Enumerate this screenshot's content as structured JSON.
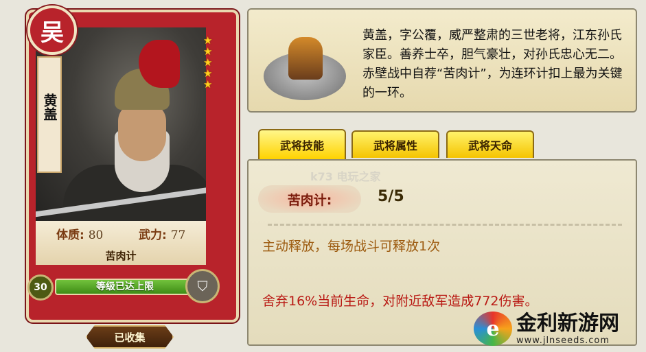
{
  "card": {
    "faction": "吴",
    "name": "黄盖",
    "stars": 5,
    "constitution_label": "体质:",
    "constitution_value": "80",
    "power_label": "武力:",
    "power_value": "77",
    "skill": "苦肉计",
    "level": "30",
    "level_status": "等级已达上限",
    "collected_label": "已收集"
  },
  "description": "黄盖，字公覆，威严整肃的三世老将，江东孙氏家臣。善养士卒，胆气豪壮，对孙氏忠心无二。赤壁战中自荐“苦肉计”，为连环计扣上最为关键的一环。",
  "tabs": [
    {
      "label": "武将技能",
      "active": true
    },
    {
      "label": "武将属性",
      "active": false
    },
    {
      "label": "武将天命",
      "active": false
    }
  ],
  "skill": {
    "name": "苦肉计:",
    "level": "5/5",
    "type": "主动释放，每场战斗可释放1次",
    "effect": "舍弃16%当前生命，对附近敌军造成772伤害。"
  },
  "watermarks": {
    "k73": "k73 电玩之家",
    "site_cn": "金利新游网",
    "site_url": "www.jlnseeds.com"
  },
  "colors": {
    "card_red": "#b8232b",
    "tab_yellow": "#ffd200",
    "skill_type": "#9c5a0e",
    "skill_effect": "#b91a14"
  }
}
